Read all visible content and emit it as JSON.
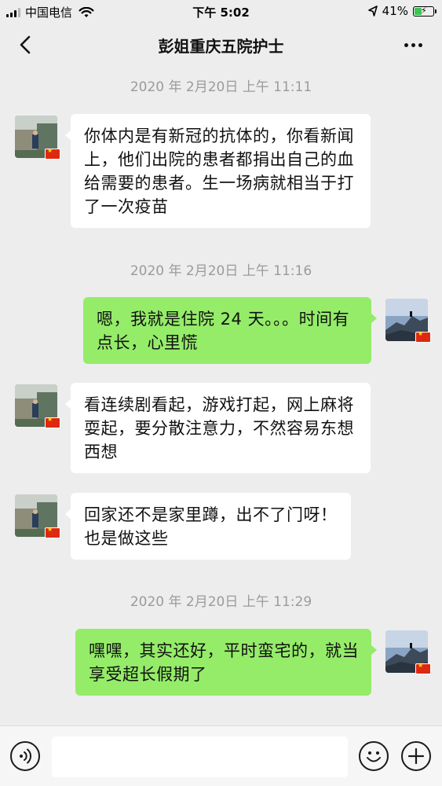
{
  "status_bar": {
    "carrier": "中国电信",
    "time": "下午 5:02",
    "battery_percent": "41%",
    "battery_level": 0.41
  },
  "header": {
    "title": "彭姐重庆五院护士"
  },
  "messages": [
    {
      "type": "timestamp",
      "text": "2020 年 2月20日 上午 11:11"
    },
    {
      "type": "received",
      "text": "你体内是有新冠的抗体的，你看新闻上，他们出院的患者都捐出自己的血给需要的患者。生一场病就相当于打了一次疫苗"
    },
    {
      "type": "timestamp",
      "text": "2020 年 2月20日 上午 11:16"
    },
    {
      "type": "sent",
      "text": "嗯，我就是住院 24 天。。。时间有点长，心里慌"
    },
    {
      "type": "received",
      "text": "看连续剧看起，游戏打起，网上麻将耍起，要分散注意力，不然容易东想西想"
    },
    {
      "type": "received",
      "text": "回家还不是家里蹲，出不了门呀！也是做这些"
    },
    {
      "type": "timestamp",
      "text": "2020 年 2月20日 上午 11:29"
    },
    {
      "type": "sent",
      "text": "嘿嘿，其实还好，平时蛮宅的，就当享受超长假期了"
    }
  ],
  "colors": {
    "background": "#ededed",
    "sent_bubble": "#95ec69",
    "received_bubble": "#ffffff",
    "timestamp_text": "#9b9b9b"
  },
  "icons": {
    "back": "chevron-left-icon",
    "more": "more-dots-icon",
    "voice": "voice-icon",
    "emoji": "emoji-icon",
    "plus": "plus-icon"
  }
}
